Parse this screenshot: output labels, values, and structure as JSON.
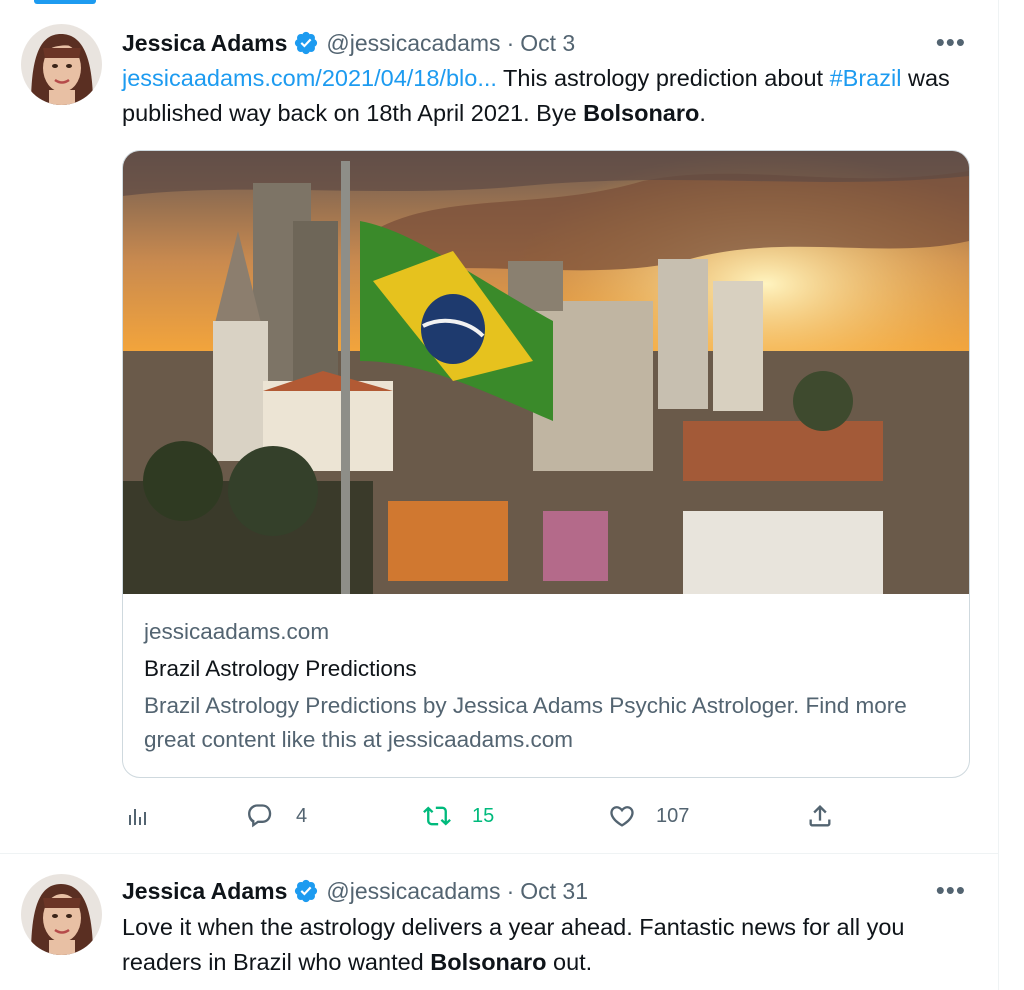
{
  "tweets": [
    {
      "name": "Jessica Adams",
      "handle": "@jessicacadams",
      "dot": "·",
      "date": "Oct 3",
      "more": "•••",
      "text": {
        "link": "jessicaadams.com/2021/04/18/blo...",
        "part1": " This astrology prediction about ",
        "hashtag": "#Brazil",
        "part2": " was published way back on 18th April 2021. Bye ",
        "bold": "Bolsonaro",
        "part3": "."
      },
      "card": {
        "domain": "jessicaadams.com",
        "title": "Brazil Astrology Predictions",
        "description": "Brazil Astrology Predictions by Jessica Adams Psychic Astrologer. Find more great content like this at jessicaadams.com"
      },
      "actions": {
        "replies": "4",
        "retweets": "15",
        "likes": "107"
      },
      "colors": {
        "retweet": "#00ba7c",
        "link": "#1d9bf0"
      }
    },
    {
      "name": "Jessica Adams",
      "handle": "@jessicacadams",
      "dot": "·",
      "date": "Oct 31",
      "more": "•••",
      "text": {
        "part1": "Love it when the astrology delivers a year ahead. Fantastic news for all you readers in Brazil who wanted ",
        "bold": "Bolsonaro",
        "part2": " out."
      }
    }
  ],
  "icons": [
    "verified-badge-icon",
    "more-icon",
    "analytics-icon",
    "reply-icon",
    "retweet-icon",
    "like-icon",
    "share-icon"
  ]
}
